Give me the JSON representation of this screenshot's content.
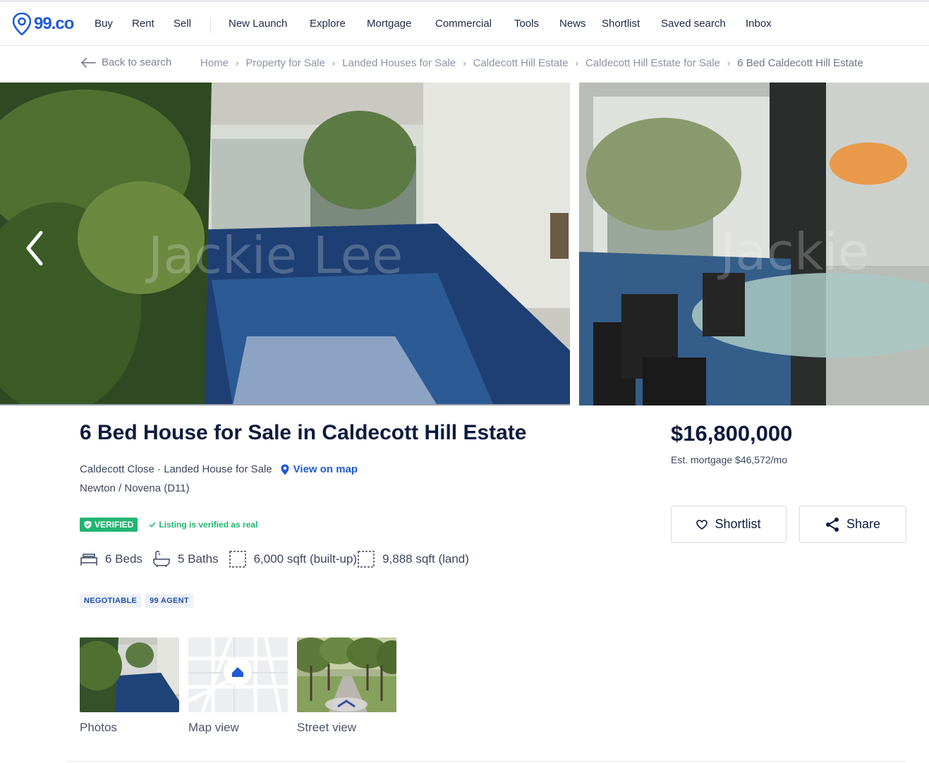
{
  "brand": {
    "logo_text": "99.co",
    "accent": "#1f5bd7"
  },
  "nav": {
    "items": [
      "Buy",
      "Rent",
      "Sell",
      "New Launch",
      "Explore",
      "Mortgage",
      "Commercial",
      "Tools",
      "News",
      "Shortlist",
      "Saved search",
      "Inbox"
    ]
  },
  "breadcrumb": {
    "back_label": "Back to search",
    "crumbs": [
      "Home",
      "Property for Sale",
      "Landed Houses for Sale",
      "Caldecott Hill Estate",
      "Caldecott Hill Estate for Sale"
    ],
    "current": "6 Bed Caldecott Hill Estate"
  },
  "gallery": {
    "watermark_1": "Jackie Lee",
    "watermark_2": "Jackie"
  },
  "listing": {
    "title": "6 Bed House for Sale in Caldecott Hill Estate",
    "address": "Caldecott Close · Landed House for Sale",
    "map_link": "View on map",
    "district": "Newton / Novena (D11)",
    "verified_badge": "VERIFIED",
    "verified_text": "Listing is verified as real",
    "verified_color": "#21b573",
    "beds": "6 Beds",
    "baths": "5 Baths",
    "built_up": "6,000 sqft (built-up)",
    "land": "9,888 sqft (land)",
    "tags": [
      "NEGOTIABLE",
      "99 AGENT"
    ]
  },
  "thumbnails": [
    {
      "label": "Photos"
    },
    {
      "label": "Map view"
    },
    {
      "label": "Street view"
    }
  ],
  "pricing": {
    "price": "$16,800,000",
    "mortgage": "Est. mortgage $46,572/mo",
    "shortlist_label": "Shortlist",
    "share_label": "Share"
  }
}
